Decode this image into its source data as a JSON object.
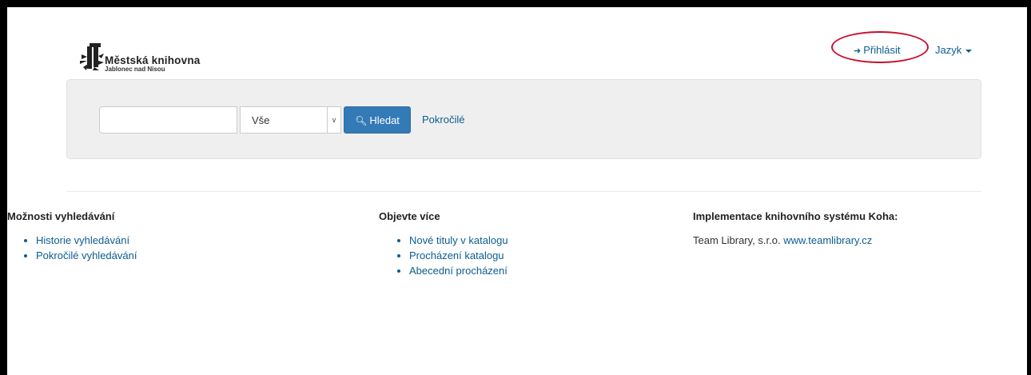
{
  "header": {
    "logo": {
      "title": "Městská knihovna",
      "subtitle": "Jablonec nad Nisou"
    },
    "login_label": "Přihlásit",
    "language_label": "Jazyk"
  },
  "search": {
    "input_value": "",
    "select_value": "Vše",
    "button_label": "Hledat",
    "advanced_label": "Pokročilé"
  },
  "footer": {
    "col1": {
      "heading": "Možnosti vyhledávání",
      "links": [
        "Historie vyhledávání",
        "Pokročilé vyhledávání"
      ]
    },
    "col2": {
      "heading": "Objevte více",
      "links": [
        "Nové tituly v katalogu",
        "Procházení katalogu",
        "Abecední procházení"
      ]
    },
    "col3": {
      "heading": "Implementace knihovního systému Koha:",
      "text": "Team Library, s.r.o.",
      "link": "www.teamlibrary.cz"
    }
  },
  "colors": {
    "link": "#0b5d91",
    "button": "#337ab7",
    "highlight_ring": "#c8102e"
  }
}
